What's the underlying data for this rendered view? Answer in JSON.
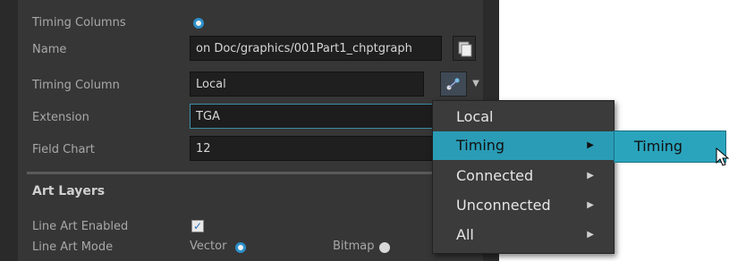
{
  "labels": {
    "timing_columns": "Timing Columns",
    "name": "Name",
    "timing_column": "Timing Column",
    "extension": "Extension",
    "field_chart": "Field Chart",
    "art_layers": "Art Layers",
    "line_art_enabled": "Line Art Enabled",
    "line_art_mode": "Line Art Mode"
  },
  "fields": {
    "name_value": "on Doc/graphics/001Part1_chptgraph",
    "timing_column_value": "Local",
    "extension_value": "TGA",
    "field_chart_value": "12"
  },
  "options": {
    "vector": "Vector",
    "bitmap": "Bitmap"
  },
  "menu": {
    "items": [
      {
        "label": "Local"
      },
      {
        "label": "Timing"
      },
      {
        "label": "Connected"
      },
      {
        "label": "Unconnected"
      },
      {
        "label": "All"
      }
    ],
    "submenu_item": "Timing"
  },
  "colors": {
    "highlight": "#2a9cb6",
    "panel": "#363636",
    "radio_accent": "#2d8fc8"
  }
}
